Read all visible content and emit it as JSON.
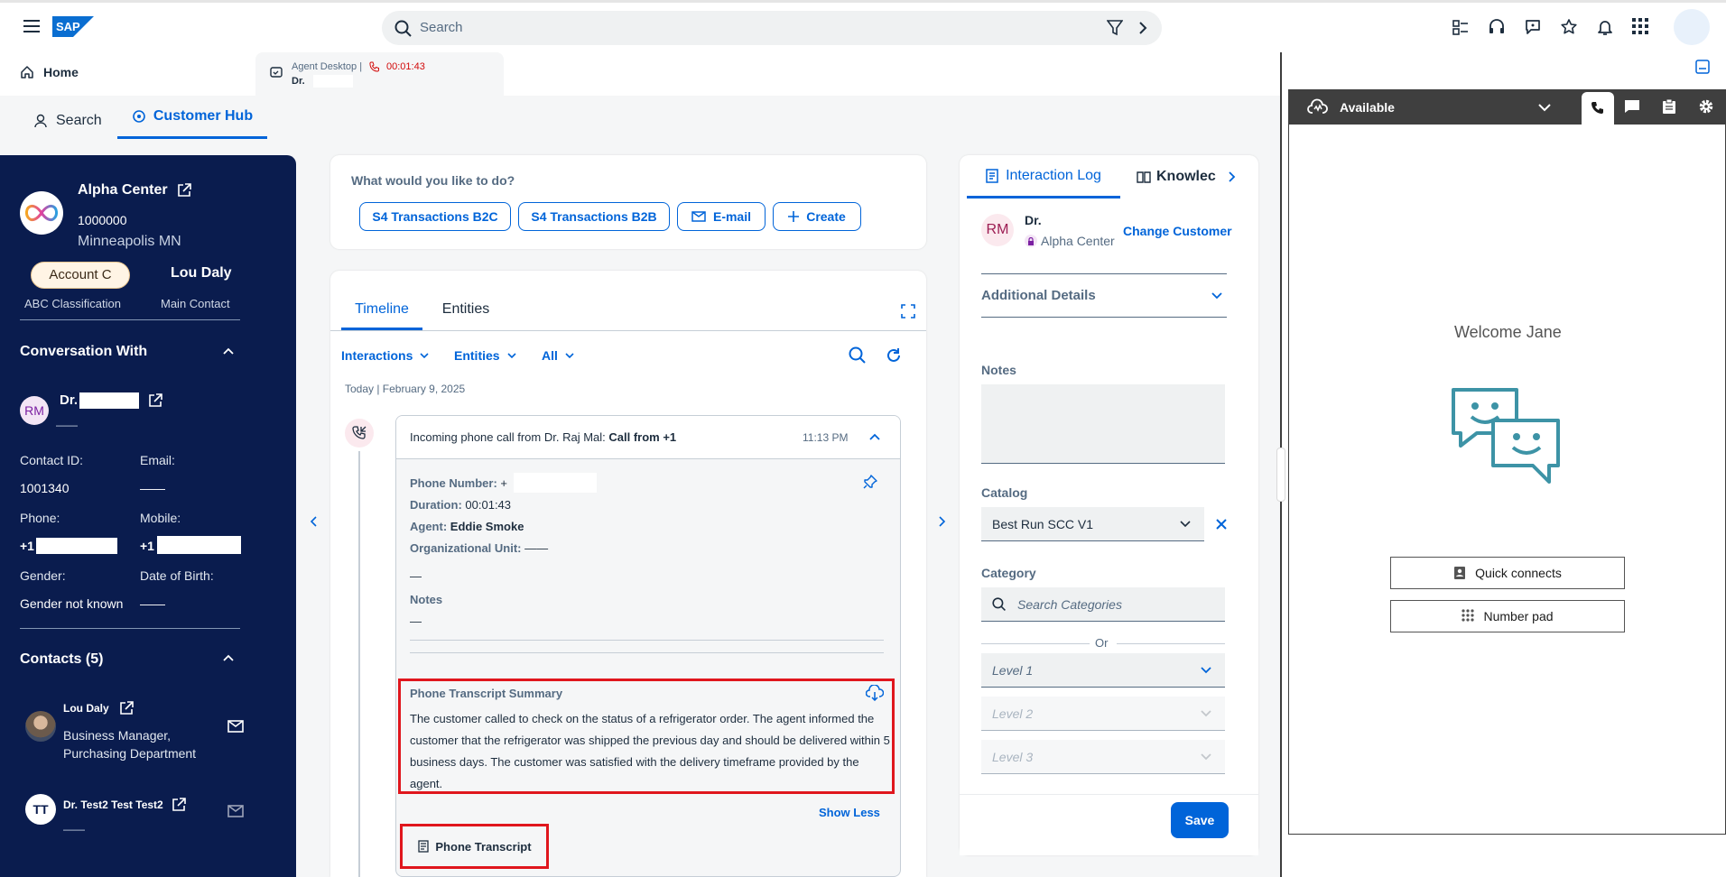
{
  "shell": {
    "search_placeholder": "Search",
    "logo": "SAP",
    "icons": [
      "menu-icon",
      "filter-icon",
      "chevron-right-icon",
      "quick-launch-icon",
      "headset-icon",
      "chat-help-icon",
      "favorites-icon",
      "notifications-icon",
      "apps-grid-icon"
    ]
  },
  "tabs": {
    "home": "Home",
    "agent_desktop": "Agent Desktop |",
    "timer": "00:01:43",
    "agent_sub": "Dr."
  },
  "subnav": {
    "search": "Search",
    "customer_hub": "Customer Hub"
  },
  "account": {
    "name": "Alpha Center",
    "id": "1000000",
    "location": "Minneapolis MN",
    "classification_value": "Account C",
    "classification_label": "ABC Classification",
    "main_contact_value": "Lou Daly",
    "main_contact_label": "Main Contact"
  },
  "conversation": {
    "title": "Conversation With",
    "initials": "RM",
    "name": "Dr.",
    "sub": "——",
    "contact_id_label": "Contact ID:",
    "contact_id": "1001340",
    "email_label": "Email:",
    "email": "——",
    "phone_label": "Phone:",
    "phone": "+1",
    "mobile_label": "Mobile:",
    "mobile": "+1",
    "gender_label": "Gender:",
    "gender": "Gender not known",
    "dob_label": "Date of Birth:",
    "dob": "——"
  },
  "contacts": {
    "title": "Contacts (5)",
    "items": [
      {
        "name": "Lou Daly",
        "role": "Business Manager, Purchasing Department"
      },
      {
        "initials": "TT",
        "name": "Dr. Test2 Test Test2",
        "role": "——"
      }
    ]
  },
  "actions": {
    "question": "What would you like to do?",
    "buttons": [
      "S4 Transactions B2C",
      "S4 Transactions B2B",
      "E-mail",
      "Create"
    ]
  },
  "timeline": {
    "tabs": [
      "Timeline",
      "Entities"
    ],
    "filters": [
      "Interactions",
      "Entities",
      "All"
    ],
    "date": "Today | February 9, 2025",
    "entry": {
      "title_prefix": "Incoming phone call from Dr. Raj Mal: ",
      "title_bold": "Call from +1",
      "time": "11:13 PM",
      "phone_label": "Phone Number:",
      "phone_value": "+",
      "duration_label": "Duration:",
      "duration_value": "00:01:43",
      "agent_label": "Agent:",
      "agent_value": "Eddie Smoke",
      "org_label": "Organizational Unit:",
      "org_value": "——",
      "dash": "—",
      "notes_label": "Notes",
      "notes_value": "—",
      "summary_title": "Phone Transcript Summary",
      "summary_text": "The customer called to check on the status of a refrigerator order. The agent informed the customer that the refrigerator was shipped the previous day and should be delivered within 5 business days. The customer was satisfied with the delivery timeframe provided by the agent.",
      "show_less": "Show Less",
      "transcript_button": "Phone Transcript"
    }
  },
  "interaction_log": {
    "tabs": [
      "Interaction Log",
      "Knowlec"
    ],
    "initials": "RM",
    "name": "Dr.",
    "account": "Alpha Center",
    "change_customer": "Change Customer",
    "additional_details": "Additional Details",
    "notes_label": "Notes",
    "catalog_label": "Catalog",
    "catalog_value": "Best Run SCC V1",
    "category_label": "Category",
    "category_placeholder": "Search Categories",
    "or": "Or",
    "levels": [
      "Level 1",
      "Level 2",
      "Level 3"
    ],
    "save": "Save"
  },
  "ccp": {
    "status": "Available",
    "welcome": "Welcome Jane",
    "quick_connects": "Quick connects",
    "number_pad": "Number pad"
  },
  "colors": {
    "accent": "#0064d9",
    "left_panel": "#0a1c4e",
    "highlight": "#e0161d",
    "timer": "#d20a0a",
    "ccp_header": "#3f3f3f",
    "ccp_icon": "#3d93a6"
  }
}
